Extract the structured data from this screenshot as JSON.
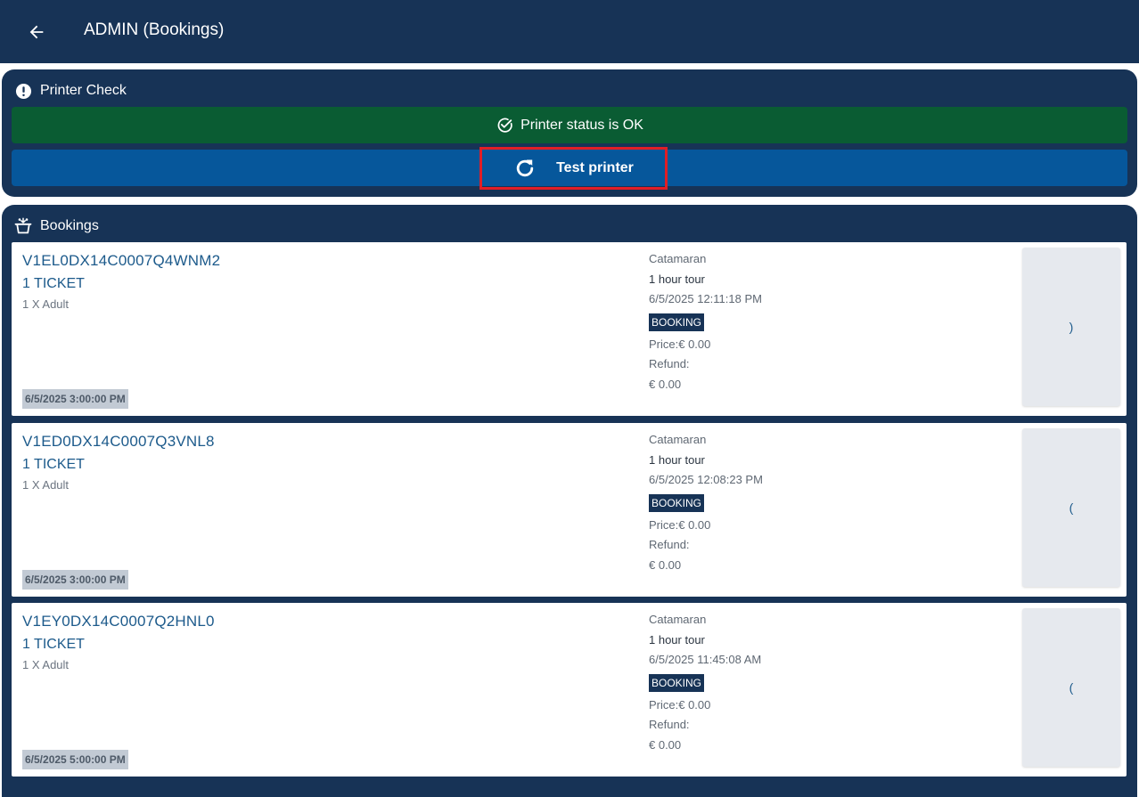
{
  "app_bar": {
    "title": "ADMIN (Bookings)"
  },
  "printer_check": {
    "title": "Printer Check",
    "status": "Printer status is OK",
    "test_button": "Test printer"
  },
  "bookings_section": {
    "title": "Bookings",
    "items": [
      {
        "code": "V1EL0DX14C0007Q4WNM2",
        "tickets": "1 TICKET",
        "detail": "1 X Adult",
        "event_date": "6/5/2025 3:00:00 PM",
        "vessel": "Catamaran",
        "tour": "1 hour tour",
        "created": "6/5/2025 12:11:18 PM",
        "status": "BOOKING",
        "price": "Price:€ 0.00",
        "refund_label": "Refund:",
        "refund_value": "€ 0.00",
        "side_glyph": ")"
      },
      {
        "code": "V1ED0DX14C0007Q3VNL8",
        "tickets": "1 TICKET",
        "detail": "1 X Adult",
        "event_date": "6/5/2025 3:00:00 PM",
        "vessel": "Catamaran",
        "tour": "1 hour tour",
        "created": "6/5/2025 12:08:23 PM",
        "status": "BOOKING",
        "price": "Price:€ 0.00",
        "refund_label": "Refund:",
        "refund_value": "€ 0.00",
        "side_glyph": "("
      },
      {
        "code": "V1EY0DX14C0007Q2HNL0",
        "tickets": "1 TICKET",
        "detail": "1 X Adult",
        "event_date": "6/5/2025 5:00:00 PM",
        "vessel": "Catamaran",
        "tour": "1 hour tour",
        "created": "6/5/2025 11:45:08 AM",
        "status": "BOOKING",
        "price": "Price:€ 0.00",
        "refund_label": "Refund:",
        "refund_value": "€ 0.00",
        "side_glyph": "("
      }
    ]
  },
  "icons": {
    "back": "arrow-left-icon",
    "printer_check": "exclamation-circle-icon",
    "status": "check-circle-icon",
    "test": "refresh-icon",
    "bookings": "basket-icon"
  },
  "colors": {
    "navy": "#173356",
    "status_green": "#0a5c33",
    "action_blue": "#06579b",
    "highlight_red": "#e01e26",
    "link_blue": "#1c5a8b"
  }
}
